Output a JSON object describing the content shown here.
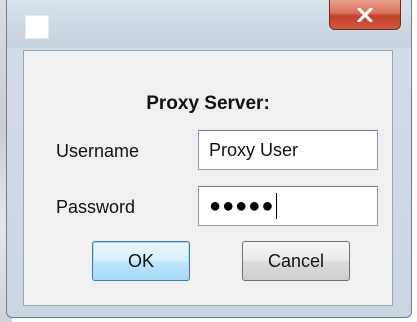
{
  "dialog": {
    "title": "Proxy Server:",
    "username_label": "Username",
    "username_value": "Proxy User",
    "password_label": "Password",
    "password_masked": "●●●●●",
    "ok_label": "OK",
    "cancel_label": "Cancel"
  },
  "icons": {
    "close": "close-icon",
    "app": "app-icon"
  },
  "colors": {
    "close_button": "#c9432c",
    "ok_border": "#3c7fb1"
  }
}
